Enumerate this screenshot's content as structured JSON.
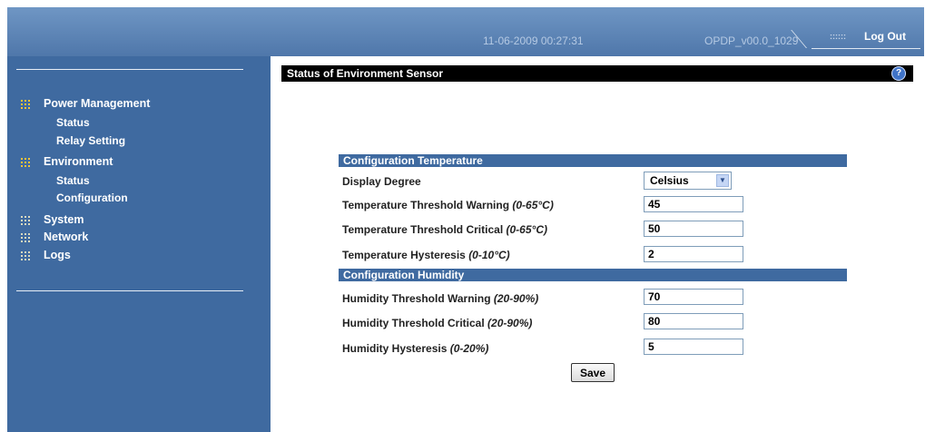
{
  "header": {
    "datetime": "11-06-2009 00:27:31",
    "version": "OPDP_v00.0_1029",
    "logout_label": "Log Out"
  },
  "sidebar": {
    "groups": [
      {
        "label": "Power Management",
        "icon": "grid-dots-icon",
        "items": [
          "Status",
          "Relay Setting"
        ]
      },
      {
        "label": "Environment",
        "icon": "grid-dots-icon",
        "items": [
          "Status",
          "Configuration"
        ]
      },
      {
        "label": "System",
        "icon": "grid-dots-icon",
        "items": []
      },
      {
        "label": "Network",
        "icon": "grid-dots-icon",
        "items": []
      },
      {
        "label": "Logs",
        "icon": "grid-dots-icon",
        "items": []
      }
    ]
  },
  "main": {
    "title": "Status of Environment Sensor",
    "help_icon": "?",
    "temp_section": "Configuration Temperature",
    "display_degree_label": "Display Degree",
    "display_degree_value": "Celsius",
    "temp_warning_label": "Temperature Threshold Warning ",
    "temp_warning_range": "(0-65°C)",
    "temp_warning_value": "45",
    "temp_critical_label": "Temperature Threshold Critical ",
    "temp_critical_range": "(0-65°C)",
    "temp_critical_value": "50",
    "temp_hyst_label": "Temperature Hysteresis ",
    "temp_hyst_range": "(0-10°C)",
    "temp_hyst_value": "2",
    "hum_section": "Configuration Humidity",
    "hum_warning_label": "Humidity Threshold Warning ",
    "hum_warning_range": "(20-90%)",
    "hum_warning_value": "70",
    "hum_critical_label": "Humidity Threshold Critical ",
    "hum_critical_range": "(20-90%)",
    "hum_critical_value": "80",
    "hum_hyst_label": "Humidity Hysteresis ",
    "hum_hyst_range": "(0-20%)",
    "hum_hyst_value": "5",
    "save_label": "Save"
  },
  "colors": {
    "header_bg": "#5a82b4",
    "sidebar_bg": "#3f6aa0",
    "section_bar": "#3f6aa0",
    "title_bar": "#000000"
  }
}
